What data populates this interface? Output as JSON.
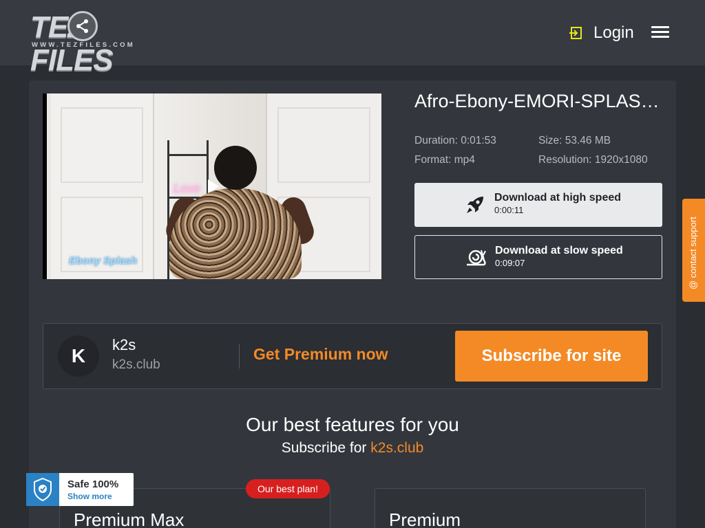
{
  "header": {
    "logo_text": "TEZ FILES",
    "logo_sub": "WWW.TEZFILES.COM",
    "login_label": "Login"
  },
  "file": {
    "title": "Afro-Ebony-EMORI-SPLASH...",
    "duration": "Duration: 0:01:53",
    "size": "Size: 53.46 MB",
    "format": "Format: mp4",
    "resolution": "Resolution: 1920x1080"
  },
  "downloads": {
    "fast": {
      "label": "Download at high speed",
      "time": "0:00:11"
    },
    "slow": {
      "label": "Download at slow speed",
      "time": "0:09:07"
    }
  },
  "support": {
    "label": "@ contact support"
  },
  "premium": {
    "avatar_letter": "K",
    "name": "k2s",
    "site": "k2s.club",
    "cta": "Get Premium now",
    "subscribe": "Subscribe for site"
  },
  "features": {
    "heading": "Our best features for you",
    "sub_prefix": "Subscribe for",
    "sub_site": "k2s.club"
  },
  "plans": [
    {
      "name": "Premium Max",
      "badge": "Our best plan!"
    },
    {
      "name": "Premium"
    }
  ],
  "safe": {
    "title": "Safe 100%",
    "more": "Show more"
  },
  "colors": {
    "accent": "#f48a26",
    "badge": "#d81f1f",
    "shield": "#2a82c5"
  }
}
